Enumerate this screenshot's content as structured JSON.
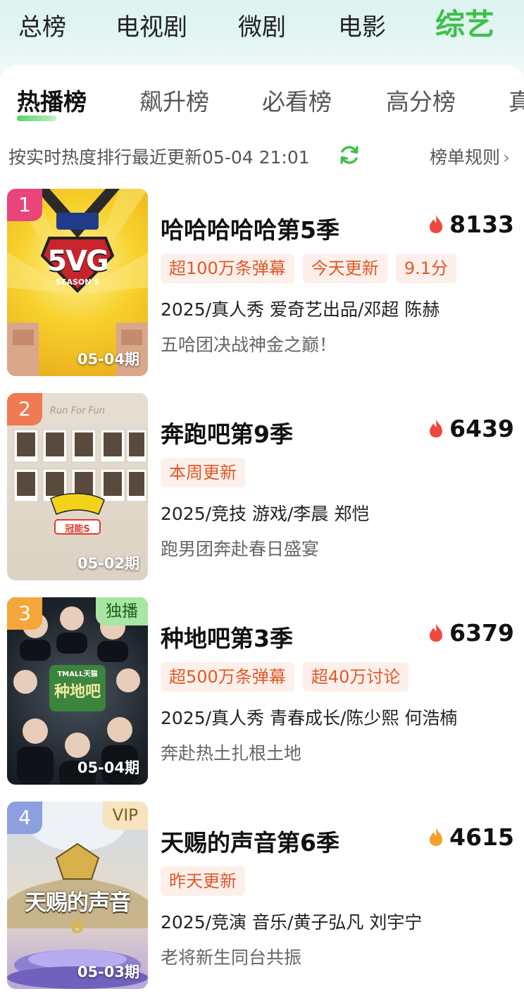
{
  "categories": [
    "总榜",
    "电视剧",
    "微剧",
    "电影",
    "综艺"
  ],
  "active_category": "综艺",
  "sub_tabs": [
    "热播榜",
    "飙升榜",
    "必看榜",
    "高分榜",
    "真"
  ],
  "active_sub_tab": "热播榜",
  "info": {
    "text": "按实时热度排行最近更新05-04 21:01",
    "rules": "榜单规则",
    "rules_chevron": "›"
  },
  "colors": {
    "accent_green": "#3fbf4a",
    "tag_bg": "#fdf0ea",
    "tag_text": "#e0582a",
    "rank1": "#e9457a",
    "rank2": "#f07a52",
    "rank3": "#f4a63b",
    "rank4": "#8c9fe0"
  },
  "items": [
    {
      "rank": "1",
      "title": "哈哈哈哈哈第5季",
      "heat": "8133",
      "tags": [
        "超100万条弹幕",
        "今天更新",
        "9.1分"
      ],
      "meta": "2025/真人秀 爱奇艺出品/邓超 陈赫",
      "desc": "五哈团决战神金之巅！",
      "episode": "05-04期",
      "corner": "",
      "poster_text": "5VG",
      "poster_sub": "SEASON 5"
    },
    {
      "rank": "2",
      "title": "奔跑吧第9季",
      "heat": "6439",
      "tags": [
        "本周更新"
      ],
      "meta": "2025/竞技 游戏/李晨 郑恺",
      "desc": "跑男团奔赴春日盛宴",
      "episode": "05-02期",
      "corner": "",
      "poster_text": "Run For Fun",
      "poster_sub": "冠能S"
    },
    {
      "rank": "3",
      "title": "种地吧第3季",
      "heat": "6379",
      "tags": [
        "超500万条弹幕",
        "超40万讨论"
      ],
      "meta": "2025/真人秀 青春成长/陈少熙 何浩楠",
      "desc": "奔赴热土扎根土地",
      "episode": "05-04期",
      "corner": "独播",
      "poster_text": "种地吧",
      "poster_sub": "TMALL天猫"
    },
    {
      "rank": "4",
      "title": "天赐的声音第6季",
      "heat": "4615",
      "tags": [
        "昨天更新"
      ],
      "meta": "2025/竞演 音乐/黄子弘凡 刘宇宁",
      "desc": "老将新生同台共振",
      "episode": "05-03期",
      "corner": "VIP",
      "poster_text": "天赐的声音",
      "poster_sub": "6"
    }
  ]
}
